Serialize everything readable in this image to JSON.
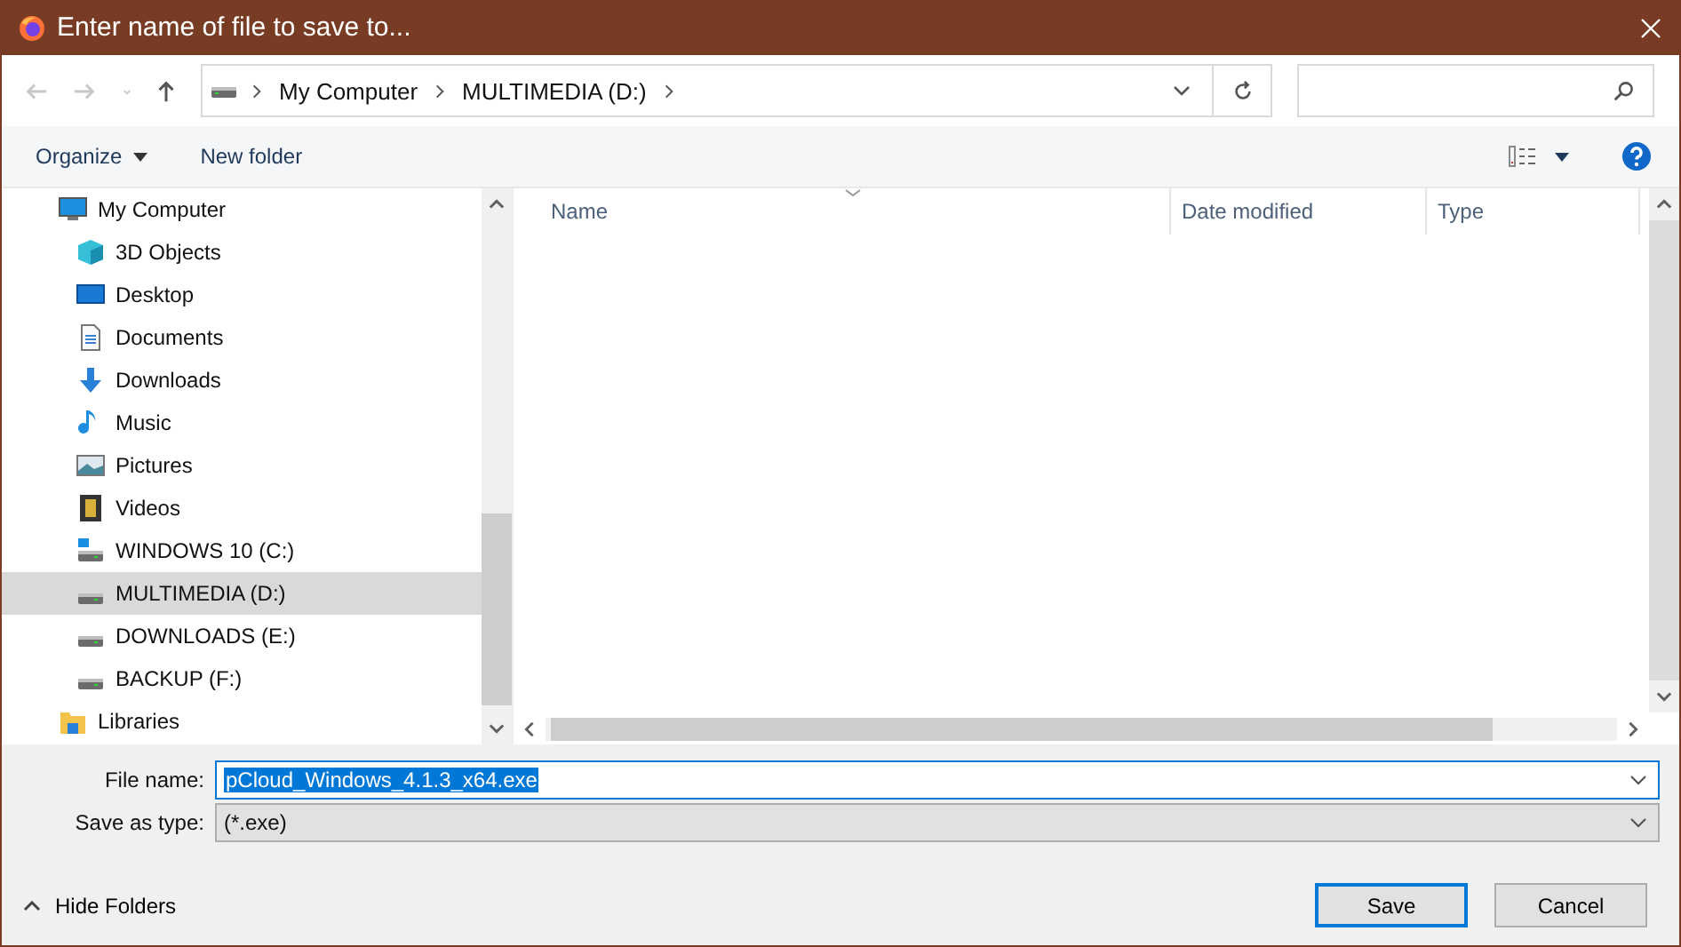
{
  "window": {
    "title": "Enter name of file to save to..."
  },
  "nav_buttons": [
    {
      "kind": "back",
      "disabled": true
    },
    {
      "kind": "forward",
      "disabled": true
    },
    {
      "kind": "recent",
      "disabled": true
    },
    {
      "kind": "up",
      "disabled": false
    }
  ],
  "breadcrumb": [
    "My Computer",
    "MULTIMEDIA (D:)"
  ],
  "toolbar": {
    "organize": "Organize",
    "new_folder": "New folder"
  },
  "sidebar": {
    "items": [
      {
        "label": "My Computer",
        "kind": "computer",
        "selected": false,
        "children": [
          {
            "label": "3D Objects",
            "kind": "cube",
            "selected": false
          },
          {
            "label": "Desktop",
            "kind": "desktop",
            "selected": false
          },
          {
            "label": "Documents",
            "kind": "document",
            "selected": false
          },
          {
            "label": "Downloads",
            "kind": "download",
            "selected": false
          },
          {
            "label": "Music",
            "kind": "music",
            "selected": false
          },
          {
            "label": "Pictures",
            "kind": "pictures",
            "selected": false
          },
          {
            "label": "Videos",
            "kind": "video",
            "selected": false
          },
          {
            "label": "WINDOWS 10 (C:)",
            "kind": "system-drive",
            "selected": false
          },
          {
            "label": "MULTIMEDIA (D:)",
            "kind": "drive",
            "selected": true
          },
          {
            "label": "DOWNLOADS (E:)",
            "kind": "drive",
            "selected": false
          },
          {
            "label": "BACKUP (F:)",
            "kind": "drive",
            "selected": false
          }
        ]
      },
      {
        "label": "Libraries",
        "kind": "library",
        "selected": false
      }
    ]
  },
  "columns": [
    "Name",
    "Date modified",
    "Type"
  ],
  "file_name": {
    "label": "File name:",
    "value": "pCloud_Windows_4.1.3_x64.exe"
  },
  "save_as_type": {
    "label": "Save as type:",
    "value": "(*.exe)"
  },
  "hide_folders": "Hide Folders",
  "buttons": [
    {
      "label": "Save",
      "default": true
    },
    {
      "label": "Cancel",
      "default": false
    }
  ]
}
